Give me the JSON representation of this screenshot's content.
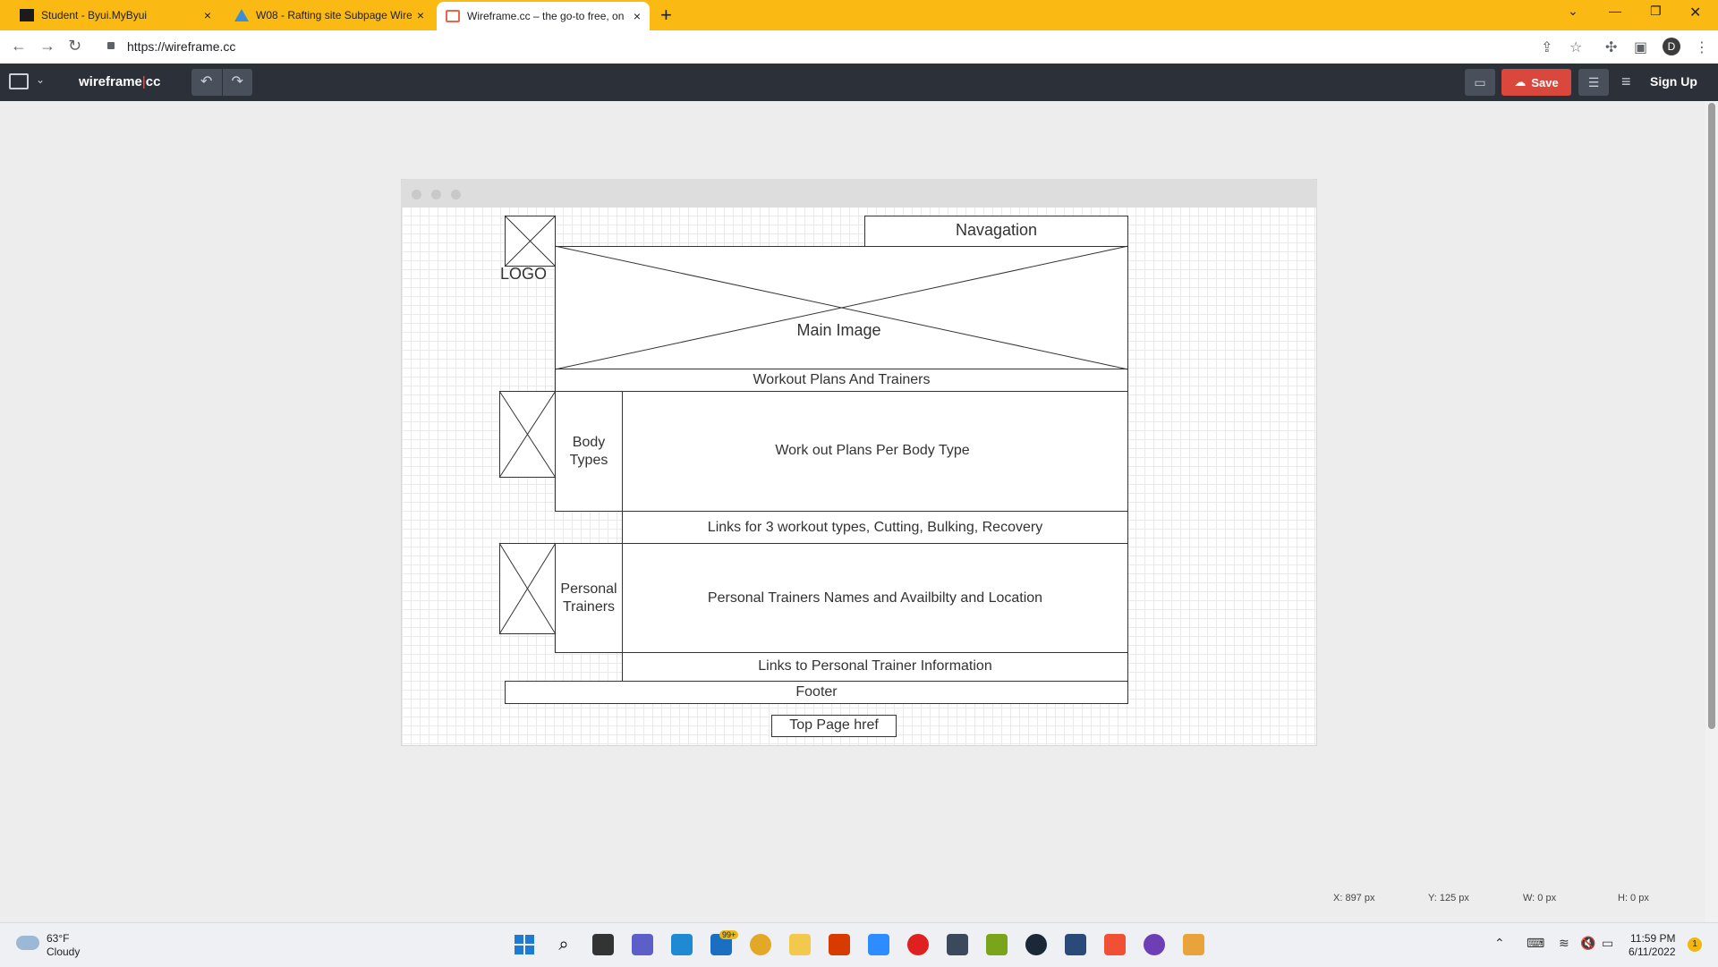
{
  "browser": {
    "tabs": [
      {
        "title": "Student - Byui.MyByui",
        "favicon": "byui-icon",
        "close": "×",
        "active": false
      },
      {
        "title": "W08 - Rafting site Subpage Wire",
        "favicon": "drive-icon",
        "close": "×",
        "active": false
      },
      {
        "title": "Wireframe.cc – the go-to free, on",
        "favicon": "wireframe-icon",
        "close": "×",
        "active": true
      }
    ],
    "new_tab": "+",
    "url": "https://wireframe.cc",
    "profile_initial": "D"
  },
  "app": {
    "brand_left": "wireframe",
    "brand_sep": "|",
    "brand_right": "cc",
    "undo": "↶",
    "redo": "↷",
    "save_label": "Save",
    "signup_label": "Sign Up"
  },
  "wireframe": {
    "logo_label": "LOGO",
    "navigation_label": "Navagation",
    "main_image_label": "Main Image",
    "workout_header": "Workout Plans And Trainers",
    "body_types_label": "Body\nTypes",
    "body_types_content": "Work out Plans Per Body Type",
    "workout_links": "Links for 3 workout types, Cutting, Bulking, Recovery",
    "trainers_label": "Personal\nTrainers",
    "trainers_content": "Personal Trainers Names and Availbilty and Location",
    "trainer_links": "Links to Personal Trainer Information",
    "footer_label": "Footer",
    "top_link_label": "Top Page href"
  },
  "status": {
    "x": "X: 897 px",
    "y": "Y: 125 px",
    "w": "W: 0 px",
    "h": "H: 0 px"
  },
  "taskbar": {
    "temperature": "63°F",
    "weather": "Cloudy",
    "time": "11:59 PM",
    "date": "6/11/2022",
    "mail_badge": "99+",
    "notification_count": "1"
  }
}
